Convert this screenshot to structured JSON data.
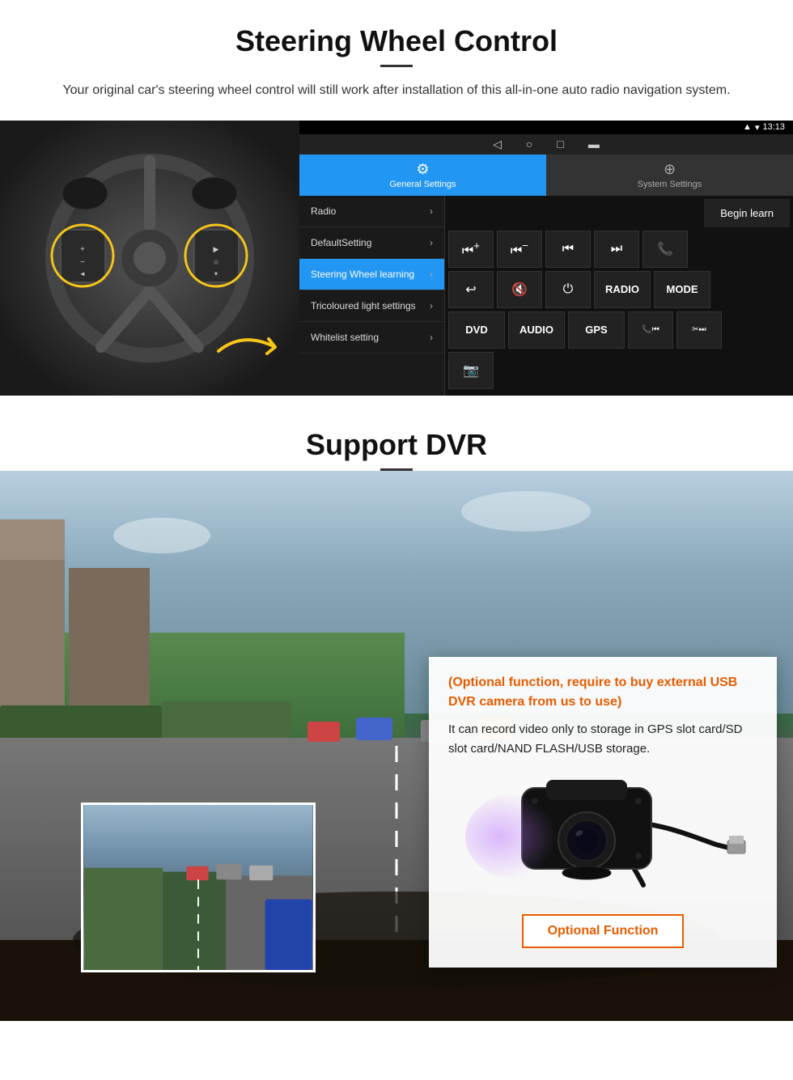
{
  "section1": {
    "title": "Steering Wheel Control",
    "subtitle": "Your original car's steering wheel control will still work after installation of this all-in-one auto radio navigation system.",
    "android_ui": {
      "time": "13:13",
      "tabs": [
        {
          "label": "General Settings",
          "active": true
        },
        {
          "label": "System Settings",
          "active": false
        }
      ],
      "menu_items": [
        {
          "label": "Radio",
          "active": false
        },
        {
          "label": "DefaultSetting",
          "active": false
        },
        {
          "label": "Steering Wheel learning",
          "active": true
        },
        {
          "label": "Tricoloured light settings",
          "active": false
        },
        {
          "label": "Whitelist setting",
          "active": false
        }
      ],
      "begin_learn_label": "Begin learn",
      "buttons_row1": [
        "⏮+",
        "⏮−",
        "⏮⏮",
        "⏭⏭",
        "📞"
      ],
      "buttons_row2": [
        "↩",
        "🔇",
        "⏻",
        "RADIO",
        "MODE"
      ],
      "buttons_row3": [
        "DVD",
        "AUDIO",
        "GPS",
        "📞⏮",
        "✂⏭"
      ],
      "buttons_row4": [
        "📷"
      ]
    }
  },
  "section2": {
    "title": "Support DVR",
    "optional_text": "(Optional function, require to buy external USB DVR camera from us to use)",
    "desc_text": "It can record video only to storage in GPS slot card/SD slot card/NAND FLASH/USB storage.",
    "optional_function_label": "Optional Function"
  }
}
